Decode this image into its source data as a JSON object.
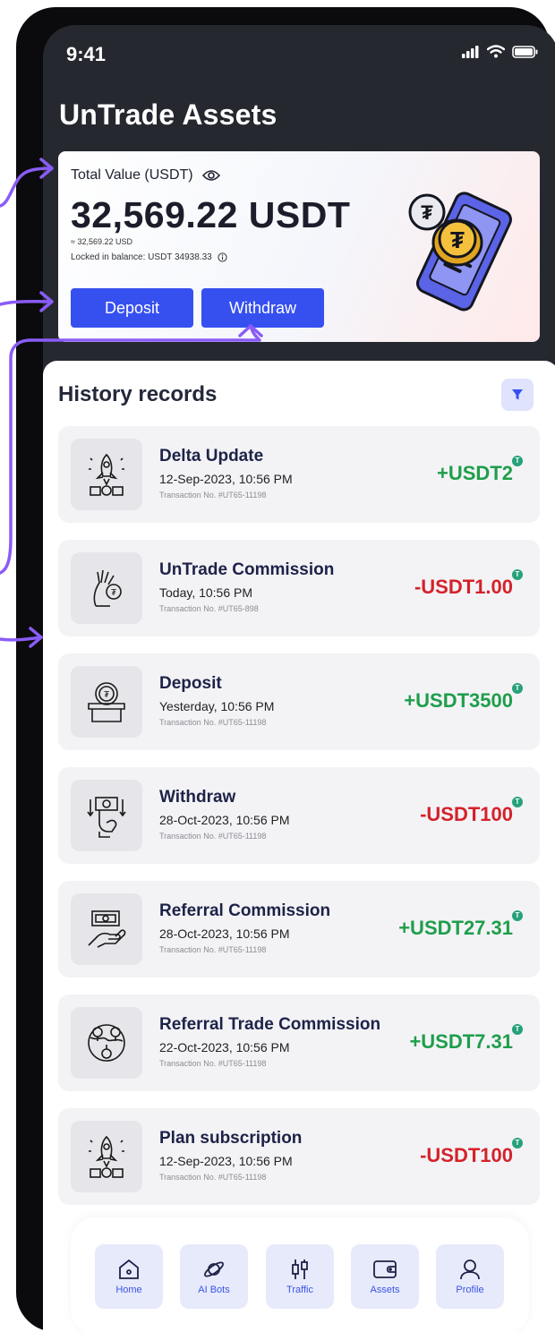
{
  "status_bar": {
    "time": "9:41"
  },
  "header": {
    "title": "UnTrade Assets"
  },
  "balance_card": {
    "label": "Total Value (USDT)",
    "amount": "32,569.22 USDT",
    "usd_equivalent": "≈ 32,569.22 USD",
    "locked": "Locked in balance: USDT 34938.33",
    "deposit_label": "Deposit",
    "withdraw_label": "Withdraw"
  },
  "history": {
    "title": "History records",
    "records": [
      {
        "title": "Delta Update",
        "date": "12-Sep-2023, 10:56 PM",
        "txn": "Transaction No. #UT65-11198",
        "amount": "+USDT2",
        "icon": "rocket-icon"
      },
      {
        "title": "UnTrade Commission",
        "date": "Today, 10:56 PM",
        "txn": "Transaction No. #UT65-898",
        "amount": "-USDT1.00",
        "icon": "hand-coin-icon"
      },
      {
        "title": "Deposit",
        "date": "Yesterday, 10:56 PM",
        "txn": "Transaction No. #UT65-11198",
        "amount": "+USDT3500",
        "icon": "deposit-box-icon"
      },
      {
        "title": "Withdraw",
        "date": "28-Oct-2023, 10:56 PM",
        "txn": "Transaction No. #UT65-11198",
        "amount": "-USDT100",
        "icon": "withdraw-cash-icon"
      },
      {
        "title": "Referral Commission",
        "date": "28-Oct-2023, 10:56 PM",
        "txn": "Transaction No. #UT65-11198",
        "amount": "+USDT27.31",
        "icon": "money-hand-icon"
      },
      {
        "title": "Referral Trade Commission",
        "date": "22-Oct-2023, 10:56 PM",
        "txn": "Transaction No. #UT65-11198",
        "amount": "+USDT7.31",
        "icon": "globe-network-icon"
      },
      {
        "title": "Plan subscription",
        "date": "12-Sep-2023, 10:56 PM",
        "txn": "Transaction No. #UT65-11198",
        "amount": "-USDT100",
        "icon": "rocket-icon"
      }
    ]
  },
  "coin_badge": "T",
  "nav": {
    "items": [
      {
        "label": "Home",
        "icon": "home-icon"
      },
      {
        "label": "AI Bots",
        "icon": "planet-icon"
      },
      {
        "label": "Traffic",
        "icon": "candlestick-icon"
      },
      {
        "label": "Assets",
        "icon": "wallet-icon"
      },
      {
        "label": "Profile",
        "icon": "user-icon"
      }
    ]
  },
  "colors": {
    "background": "#26282f",
    "accent": "#3650f0",
    "positive": "#1e9e4a",
    "negative": "#d5222a",
    "annotation": "#8a5cf6"
  }
}
